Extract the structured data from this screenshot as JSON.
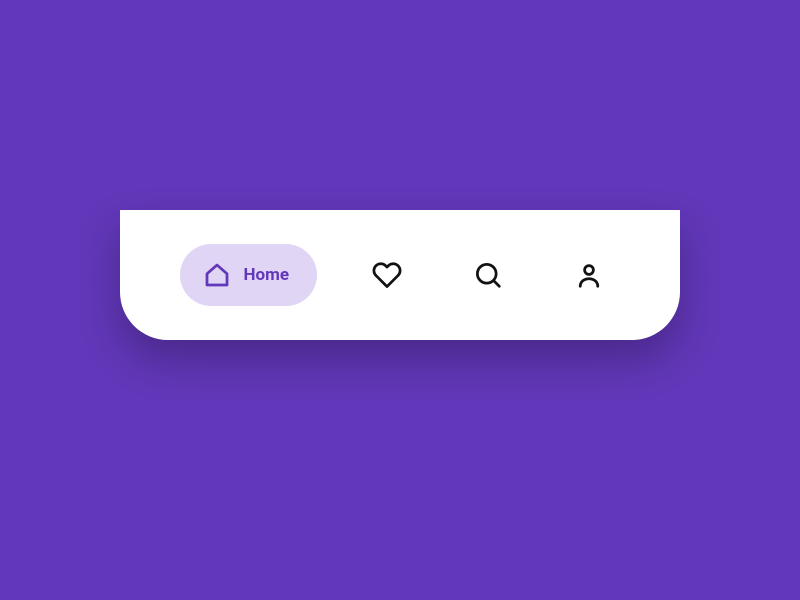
{
  "colors": {
    "background": "#6237b9",
    "card": "#ffffff",
    "active_pill": "#e0d5f5",
    "active_text": "#6237b9",
    "inactive_icon": "#121212"
  },
  "nav": {
    "items": [
      {
        "label": "Home",
        "icon": "home-icon",
        "active": true
      },
      {
        "label": "Favorites",
        "icon": "heart-icon",
        "active": false
      },
      {
        "label": "Search",
        "icon": "search-icon",
        "active": false
      },
      {
        "label": "Profile",
        "icon": "user-icon",
        "active": false
      }
    ]
  }
}
